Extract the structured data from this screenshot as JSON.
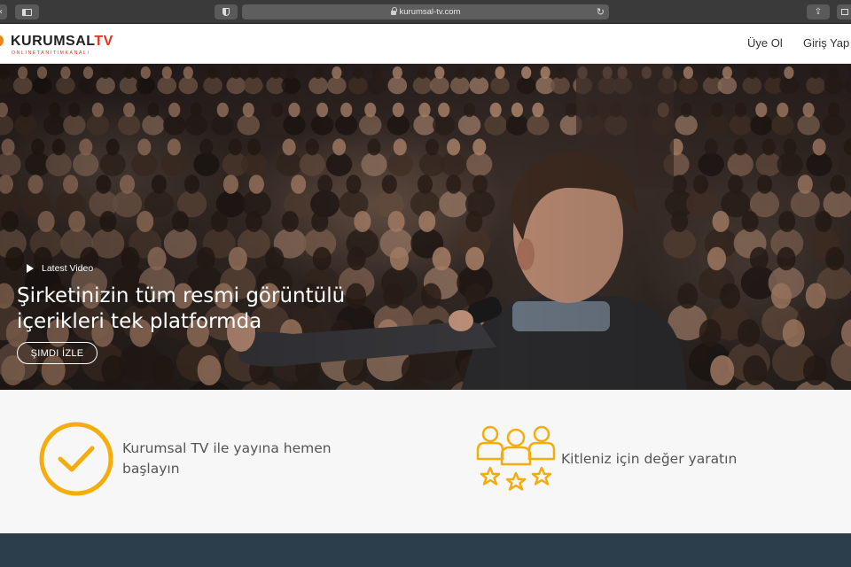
{
  "browser": {
    "url": "kurumsal-tv.com"
  },
  "header": {
    "logo_main": "KURUMSAL",
    "logo_tv": "TV",
    "logo_tagline": "ONLINETANITIMKANALI",
    "nav": [
      {
        "label": "Üye Ol"
      },
      {
        "label": "Giriş Yap"
      }
    ]
  },
  "hero": {
    "eyebrow": "Latest Video",
    "title": "Şirketinizin tüm resmi görüntülü içerikleri tek platformda",
    "cta_label": "ŞIMDI İZLE"
  },
  "features": [
    {
      "icon": "check-circle-icon",
      "text": "Kurumsal TV ile yayına hemen başlayın"
    },
    {
      "icon": "audience-stars-icon",
      "text": "Kitleniz için değer yaratın"
    }
  ],
  "colors": {
    "accent": "#f5ad0e",
    "brand_red": "#e2321e",
    "brand_orange": "#f0841e",
    "footer": "#2c3e4c"
  }
}
